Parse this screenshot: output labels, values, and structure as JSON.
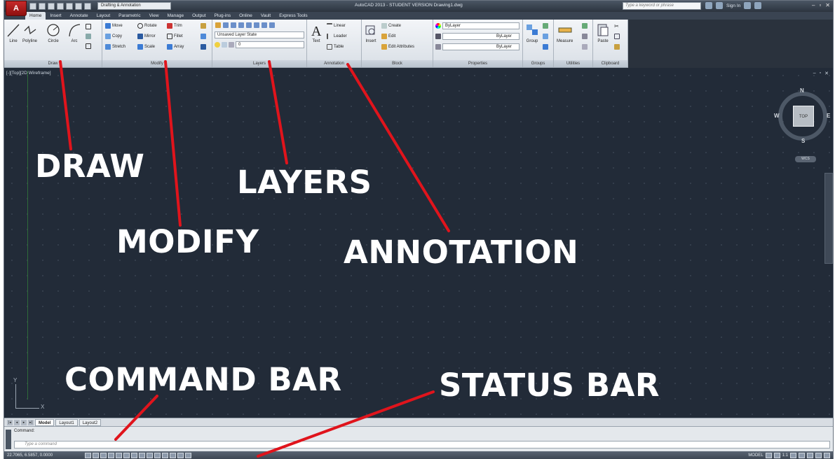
{
  "titlebar": {
    "app_letter": "A",
    "workspace": "Drafting & Annotation",
    "title": "AutoCAD 2013 - STUDENT VERSION   Drawing1.dwg",
    "search_placeholder": "Type a keyword or phrase",
    "sign_in": "Sign In"
  },
  "ribbon_tabs": [
    "Home",
    "Insert",
    "Annotate",
    "Layout",
    "Parametric",
    "View",
    "Manage",
    "Output",
    "Plug-ins",
    "Online",
    "Vault",
    "Express Tools"
  ],
  "panels": {
    "draw": {
      "title": "Draw",
      "tools": [
        "Line",
        "Polyline",
        "Circle",
        "Arc"
      ]
    },
    "modify": {
      "title": "Modify",
      "tools": [
        "Move",
        "Rotate",
        "Trim",
        "Copy",
        "Mirror",
        "Fillet",
        "Stretch",
        "Scale",
        "Array"
      ]
    },
    "layers": {
      "title": "Layers",
      "layer_state": "Unsaved Layer State",
      "current_layer": "0"
    },
    "annotation": {
      "title": "Annotation",
      "tools": [
        "Text",
        "Linear",
        "Leader",
        "Table"
      ]
    },
    "block": {
      "title": "Block",
      "tools": [
        "Insert",
        "Create",
        "Edit",
        "Edit Attributes"
      ]
    },
    "properties": {
      "title": "Properties",
      "values": [
        "ByLayer",
        "ByLayer",
        "ByLayer"
      ]
    },
    "groups": {
      "title": "Groups",
      "tools": [
        "Group"
      ]
    },
    "utilities": {
      "title": "Utilities",
      "tools": [
        "Measure"
      ]
    },
    "clipboard": {
      "title": "Clipboard",
      "tools": [
        "Paste"
      ]
    }
  },
  "viewport": {
    "label": "[-][Top][2D Wireframe]",
    "viewcube": {
      "face": "TOP",
      "n": "N",
      "s": "S",
      "e": "E",
      "w": "W",
      "wcs": "WCS"
    },
    "ucs": {
      "x": "X",
      "y": "Y"
    }
  },
  "layout_tabs": [
    "Model",
    "Layout1",
    "Layout2"
  ],
  "command": {
    "history": "Command:",
    "placeholder": "Type a command"
  },
  "status": {
    "coords": "22.7065, 6.5857, 0.0000",
    "model": "MODEL",
    "scale": "1:1"
  },
  "annotations": {
    "draw": "DRAW",
    "modify": "MODIFY",
    "layers": "LAYERS",
    "annotation": "ANNOTATION",
    "command_bar": "COMMAND BAR",
    "status_bar": "STATUS BAR"
  },
  "colors": {
    "arrow": "#e0141c",
    "viewport_bg": "#222b38",
    "app_button": "#c62a2a"
  }
}
